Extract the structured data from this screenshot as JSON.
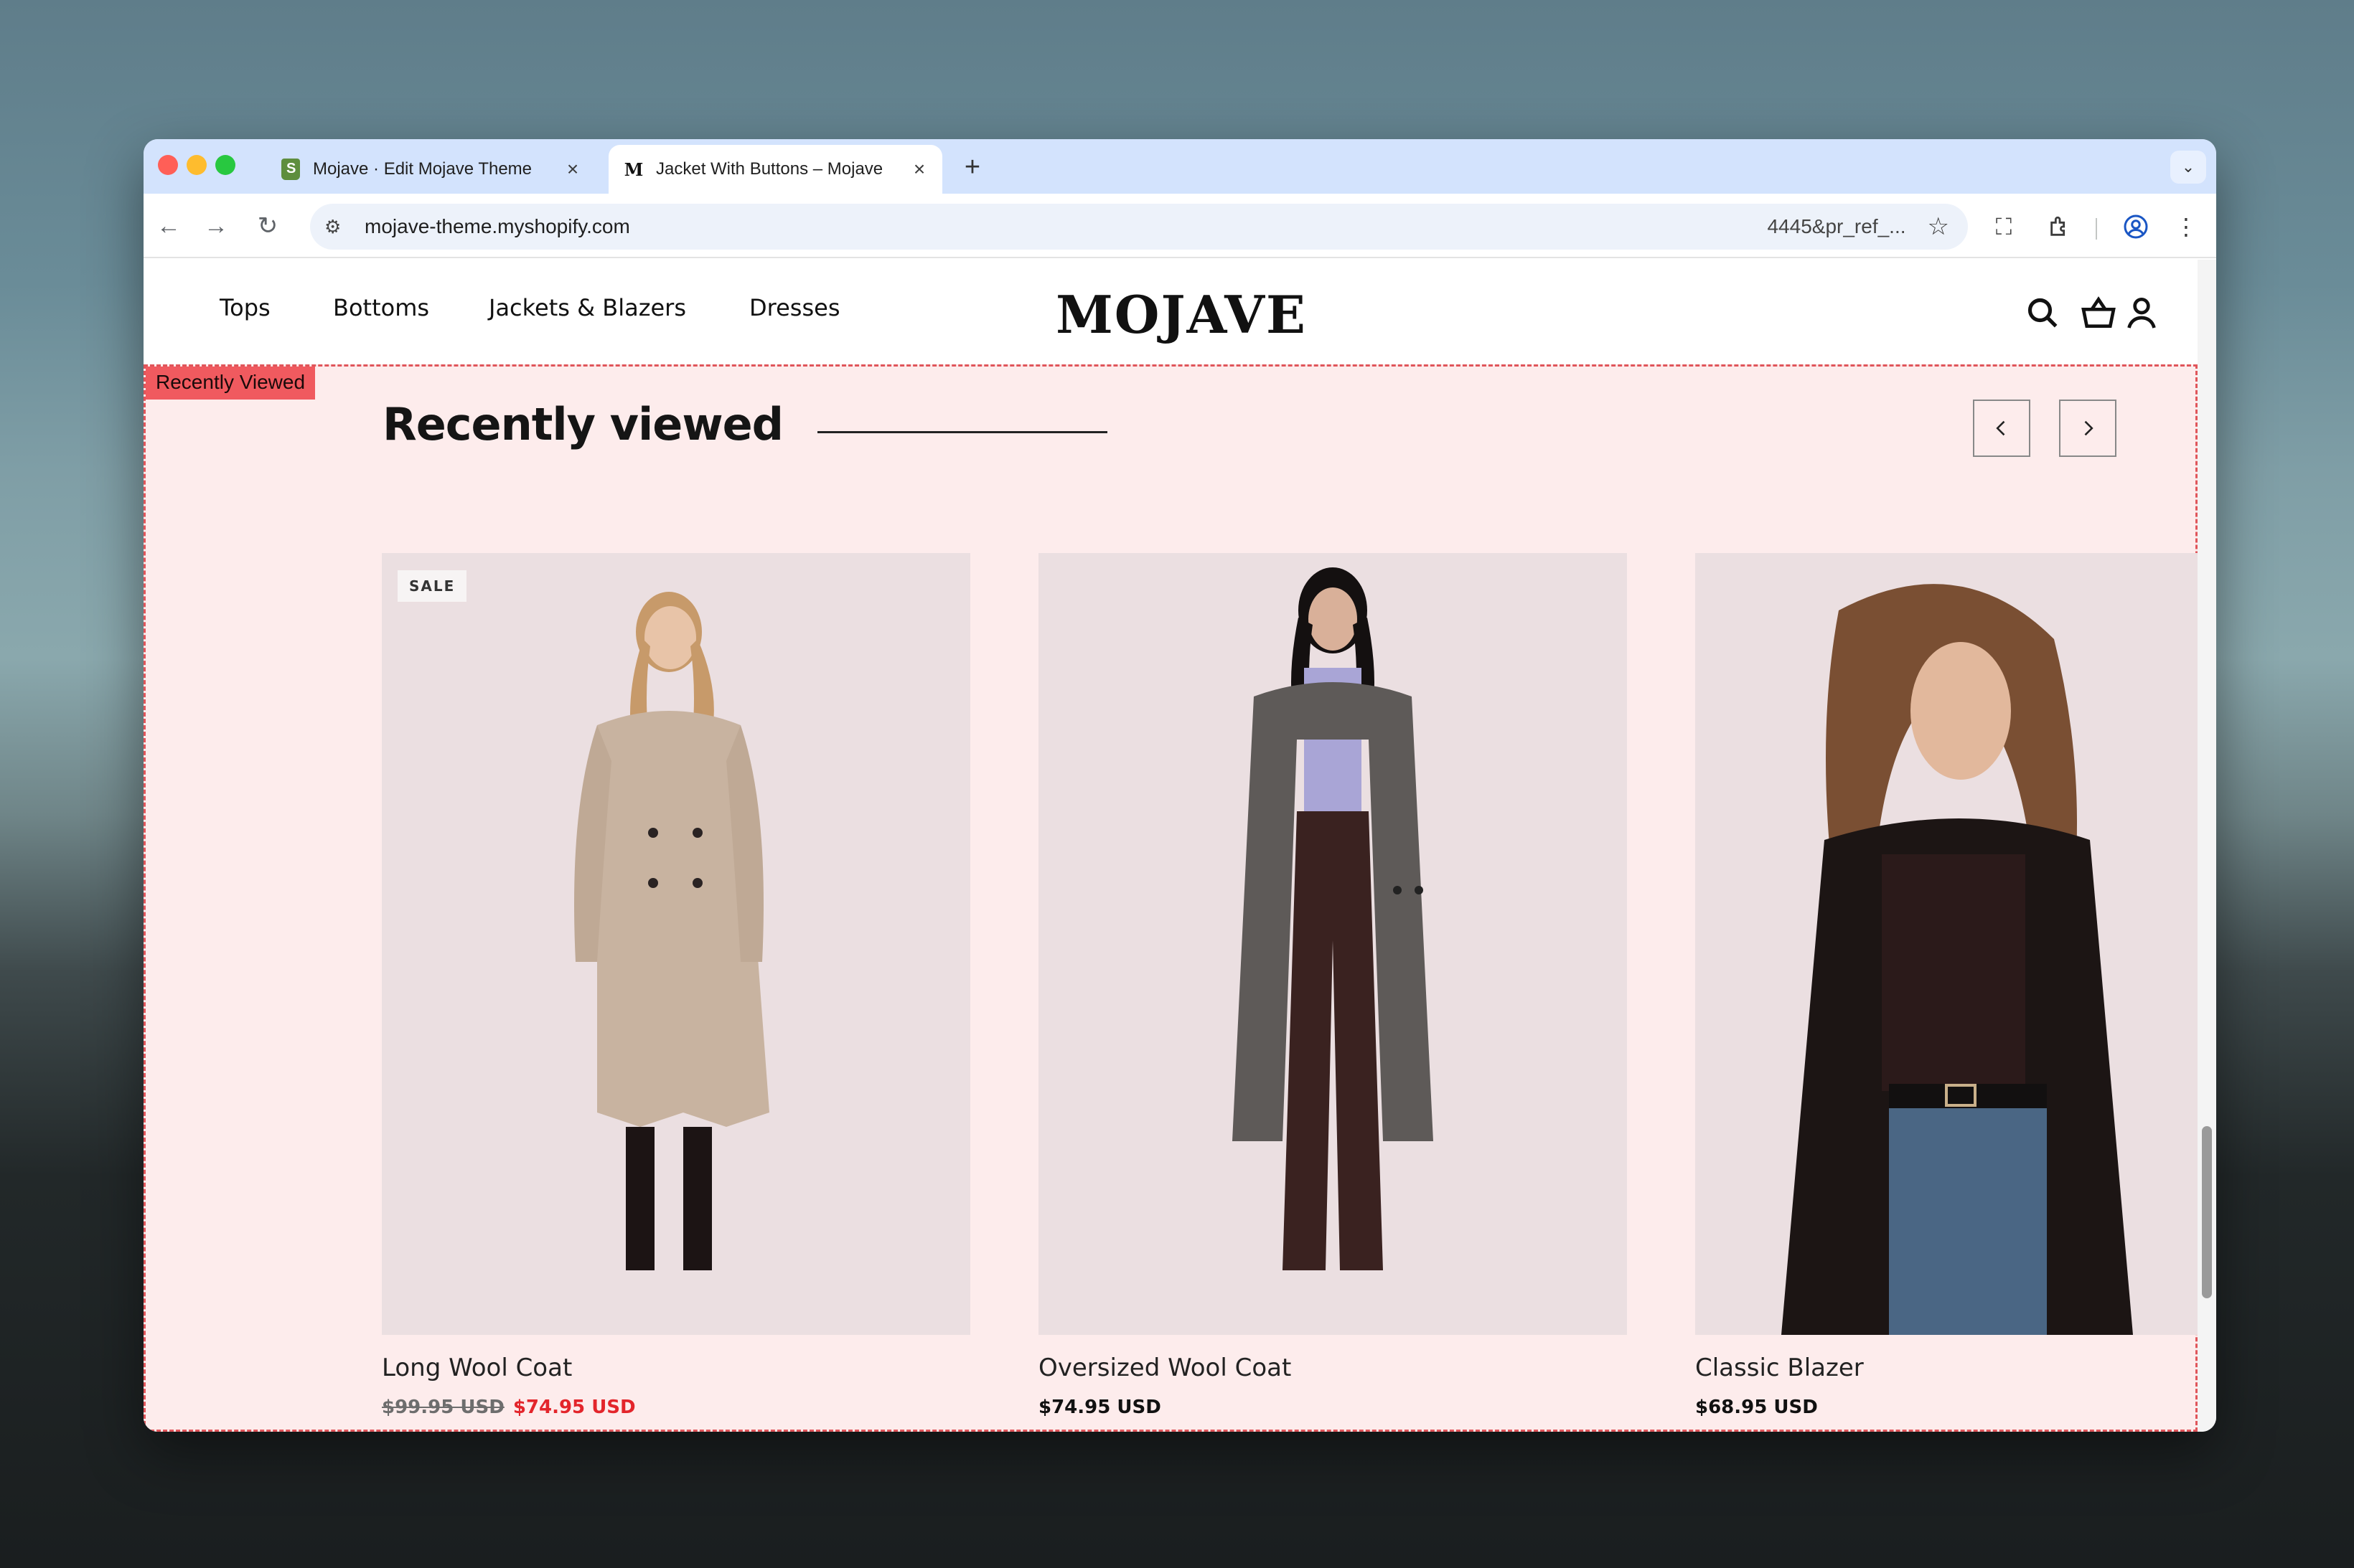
{
  "browser": {
    "tabs": [
      {
        "title": "Mojave · Edit Mojave Theme",
        "favicon": "shopify-icon",
        "active": false
      },
      {
        "title": "Jacket With Buttons – Mojave",
        "favicon": "M",
        "active": true
      }
    ],
    "new_tab": "+",
    "address": {
      "url": "mojave-theme.myshopify.com",
      "url_tail": "4445&pr_ref_..."
    }
  },
  "site": {
    "logo": "MOJAVE",
    "nav": [
      "Tops",
      "Bottoms",
      "Jackets & Blazers",
      "Dresses"
    ]
  },
  "section": {
    "tag": "Recently Viewed",
    "title": "Recently viewed",
    "prev": "‹",
    "next": "›"
  },
  "products": [
    {
      "name": "Long Wool Coat",
      "compare_price": "$99.95 USD",
      "price": "$74.95 USD",
      "badge": "SALE"
    },
    {
      "name": "Oversized Wool Coat",
      "price": "$74.95 USD"
    },
    {
      "name": "Classic Blazer",
      "price": "$68.95 USD"
    }
  ],
  "colors": {
    "accent": "#e3252b",
    "section_bg": "#fdecec",
    "section_border": "#e0555a",
    "tab_strip": "#d3e3fd"
  }
}
